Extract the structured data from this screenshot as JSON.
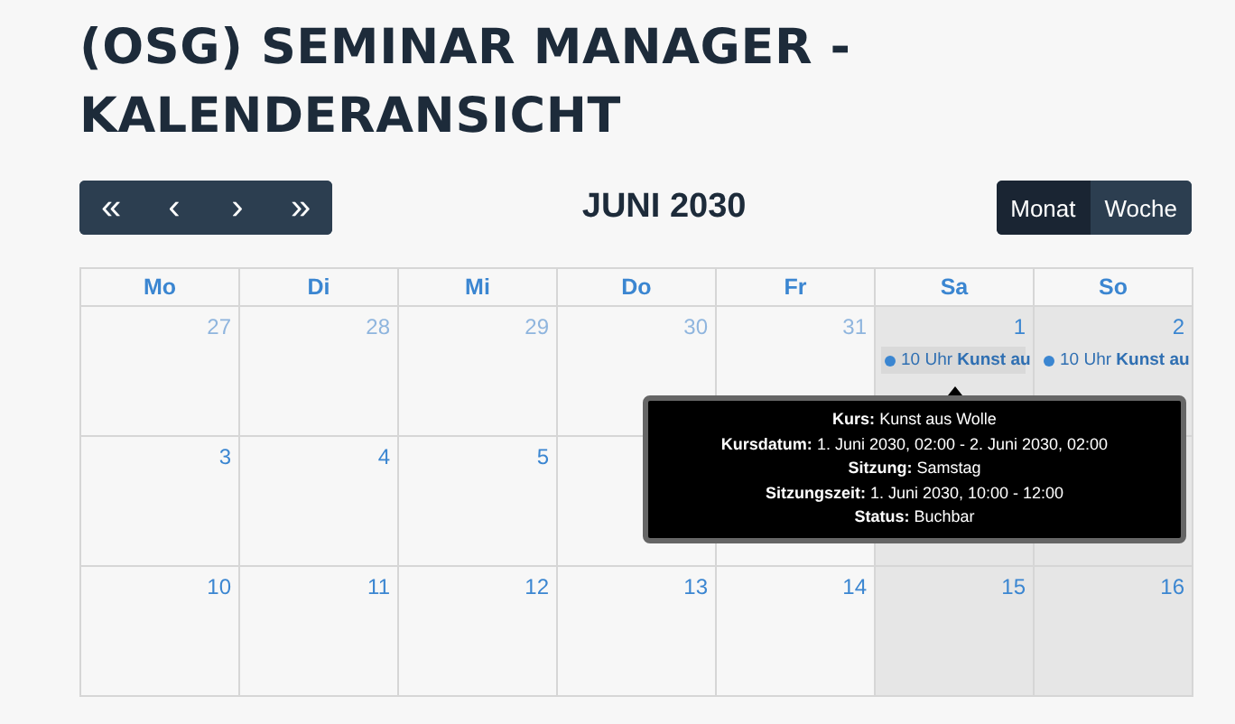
{
  "title": "(OSG) SEMINAR MANAGER - KALENDERANSICHT",
  "nav_buttons": [
    "«",
    "‹",
    "›",
    "»"
  ],
  "month_label": "JUNI 2030",
  "view_buttons": [
    {
      "label": "Monat",
      "selected": true
    },
    {
      "label": "Woche",
      "selected": false
    }
  ],
  "columns": [
    {
      "label": "Mo",
      "weekend": false
    },
    {
      "label": "Di",
      "weekend": false
    },
    {
      "label": "Mi",
      "weekend": false
    },
    {
      "label": "Do",
      "weekend": false
    },
    {
      "label": "Fr",
      "weekend": false
    },
    {
      "label": "Sa",
      "weekend": true
    },
    {
      "label": "So",
      "weekend": true
    }
  ],
  "weeks": [
    [
      {
        "day": "27",
        "muted": true
      },
      {
        "day": "28",
        "muted": true
      },
      {
        "day": "29",
        "muted": true
      },
      {
        "day": "30",
        "muted": true
      },
      {
        "day": "31",
        "muted": true
      },
      {
        "day": "1",
        "muted": false,
        "events": [
          {
            "time": "10 Uhr",
            "title": "Kunst au",
            "selected": true
          }
        ]
      },
      {
        "day": "2",
        "muted": false,
        "events": [
          {
            "time": "10 Uhr",
            "title": "Kunst au",
            "selected": false
          }
        ]
      }
    ],
    [
      {
        "day": "3",
        "muted": false
      },
      {
        "day": "4",
        "muted": false
      },
      {
        "day": "5",
        "muted": false
      }
    ],
    [
      {
        "day": "10",
        "muted": false
      },
      {
        "day": "11",
        "muted": false
      },
      {
        "day": "12",
        "muted": false
      },
      {
        "day": "13",
        "muted": false
      },
      {
        "day": "14",
        "muted": false
      },
      {
        "day": "15",
        "muted": false
      },
      {
        "day": "16",
        "muted": false
      }
    ]
  ],
  "tooltip": {
    "lines": [
      "**Kurs:** Kunst aus Wolle",
      "**Kursdatum:** 1. Juni 2030, 02:00 - 2. Juni 2030, 02:00",
      "**Sitzung:** Samstag",
      "**Sitzungszeit:** 1. Juni 2030, 10:00 - 12:00",
      "**Status:** Buchbar"
    ]
  }
}
